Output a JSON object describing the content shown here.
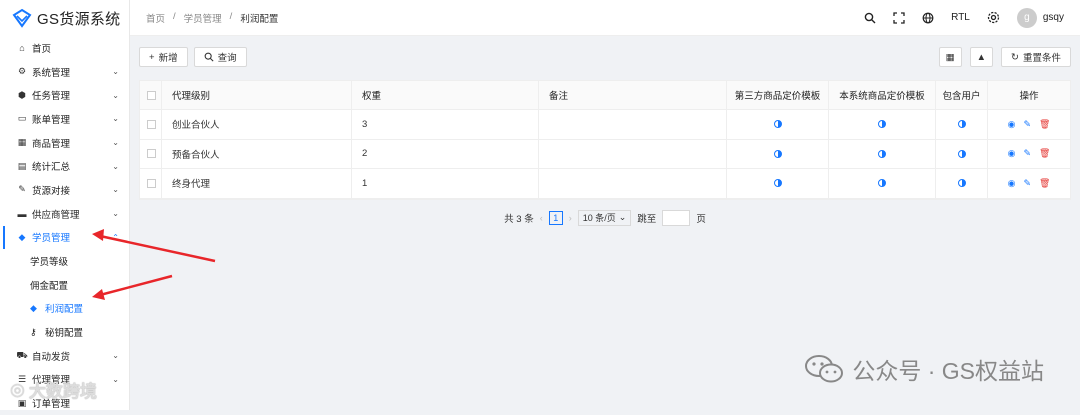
{
  "app": {
    "title": "GS货源系统"
  },
  "sidebar": {
    "items": [
      {
        "label": "首页",
        "icon": "home-icon",
        "glyph": "⌂"
      },
      {
        "label": "系统管理",
        "icon": "gears-icon",
        "glyph": "⚙"
      },
      {
        "label": "任务管理",
        "icon": "cubes-icon",
        "glyph": "⬢"
      },
      {
        "label": "账单管理",
        "icon": "bill-icon",
        "glyph": "▭"
      },
      {
        "label": "商品管理",
        "icon": "calendar-icon",
        "glyph": "▦"
      },
      {
        "label": "统计汇总",
        "icon": "table-icon",
        "glyph": "▤"
      },
      {
        "label": "货源对接",
        "icon": "plug-icon",
        "glyph": "✎"
      },
      {
        "label": "供应商管理",
        "icon": "archive-icon",
        "glyph": "▬"
      },
      {
        "label": "学员管理",
        "icon": "tag-icon",
        "glyph": "◆"
      }
    ],
    "sub_items": [
      {
        "label": "学员等级"
      },
      {
        "label": "佣金配置"
      },
      {
        "label": "利润配置",
        "glyph": "◆"
      },
      {
        "label": "秘钥配置",
        "glyph": "⚷"
      }
    ],
    "bottom_items": [
      {
        "label": "自动发货",
        "glyph": "⛟"
      },
      {
        "label": "代理管理",
        "glyph": "☰"
      },
      {
        "label": "订单管理",
        "glyph": "▣"
      }
    ]
  },
  "header": {
    "breadcrumb": [
      "首页",
      "学员管理",
      "利润配置"
    ],
    "rtl_label": "RTL",
    "user": {
      "initial": "g",
      "name": "gsqy"
    }
  },
  "toolbar": {
    "add_label": "新增",
    "query_label": "查询",
    "reset_label": "重置条件"
  },
  "table": {
    "columns": [
      "代理级别",
      "权重",
      "备注",
      "第三方商品定价模板",
      "本系统商品定价模板",
      "包含用户",
      "操作"
    ],
    "rows": [
      {
        "level": "创业合伙人",
        "weight": "3",
        "note": ""
      },
      {
        "level": "预备合伙人",
        "weight": "2",
        "note": ""
      },
      {
        "level": "终身代理",
        "weight": "1",
        "note": ""
      }
    ]
  },
  "pager": {
    "total": "共 3 条",
    "page": "1",
    "size": "10 条/页",
    "jump": "跳至",
    "page_unit": "页"
  },
  "watermark": {
    "text": "公众号 · GS权益站",
    "left_text": "大数跨境"
  },
  "colors": {
    "accent": "#1677ff",
    "danger": "#e53935",
    "annotation": "#e8262a"
  }
}
